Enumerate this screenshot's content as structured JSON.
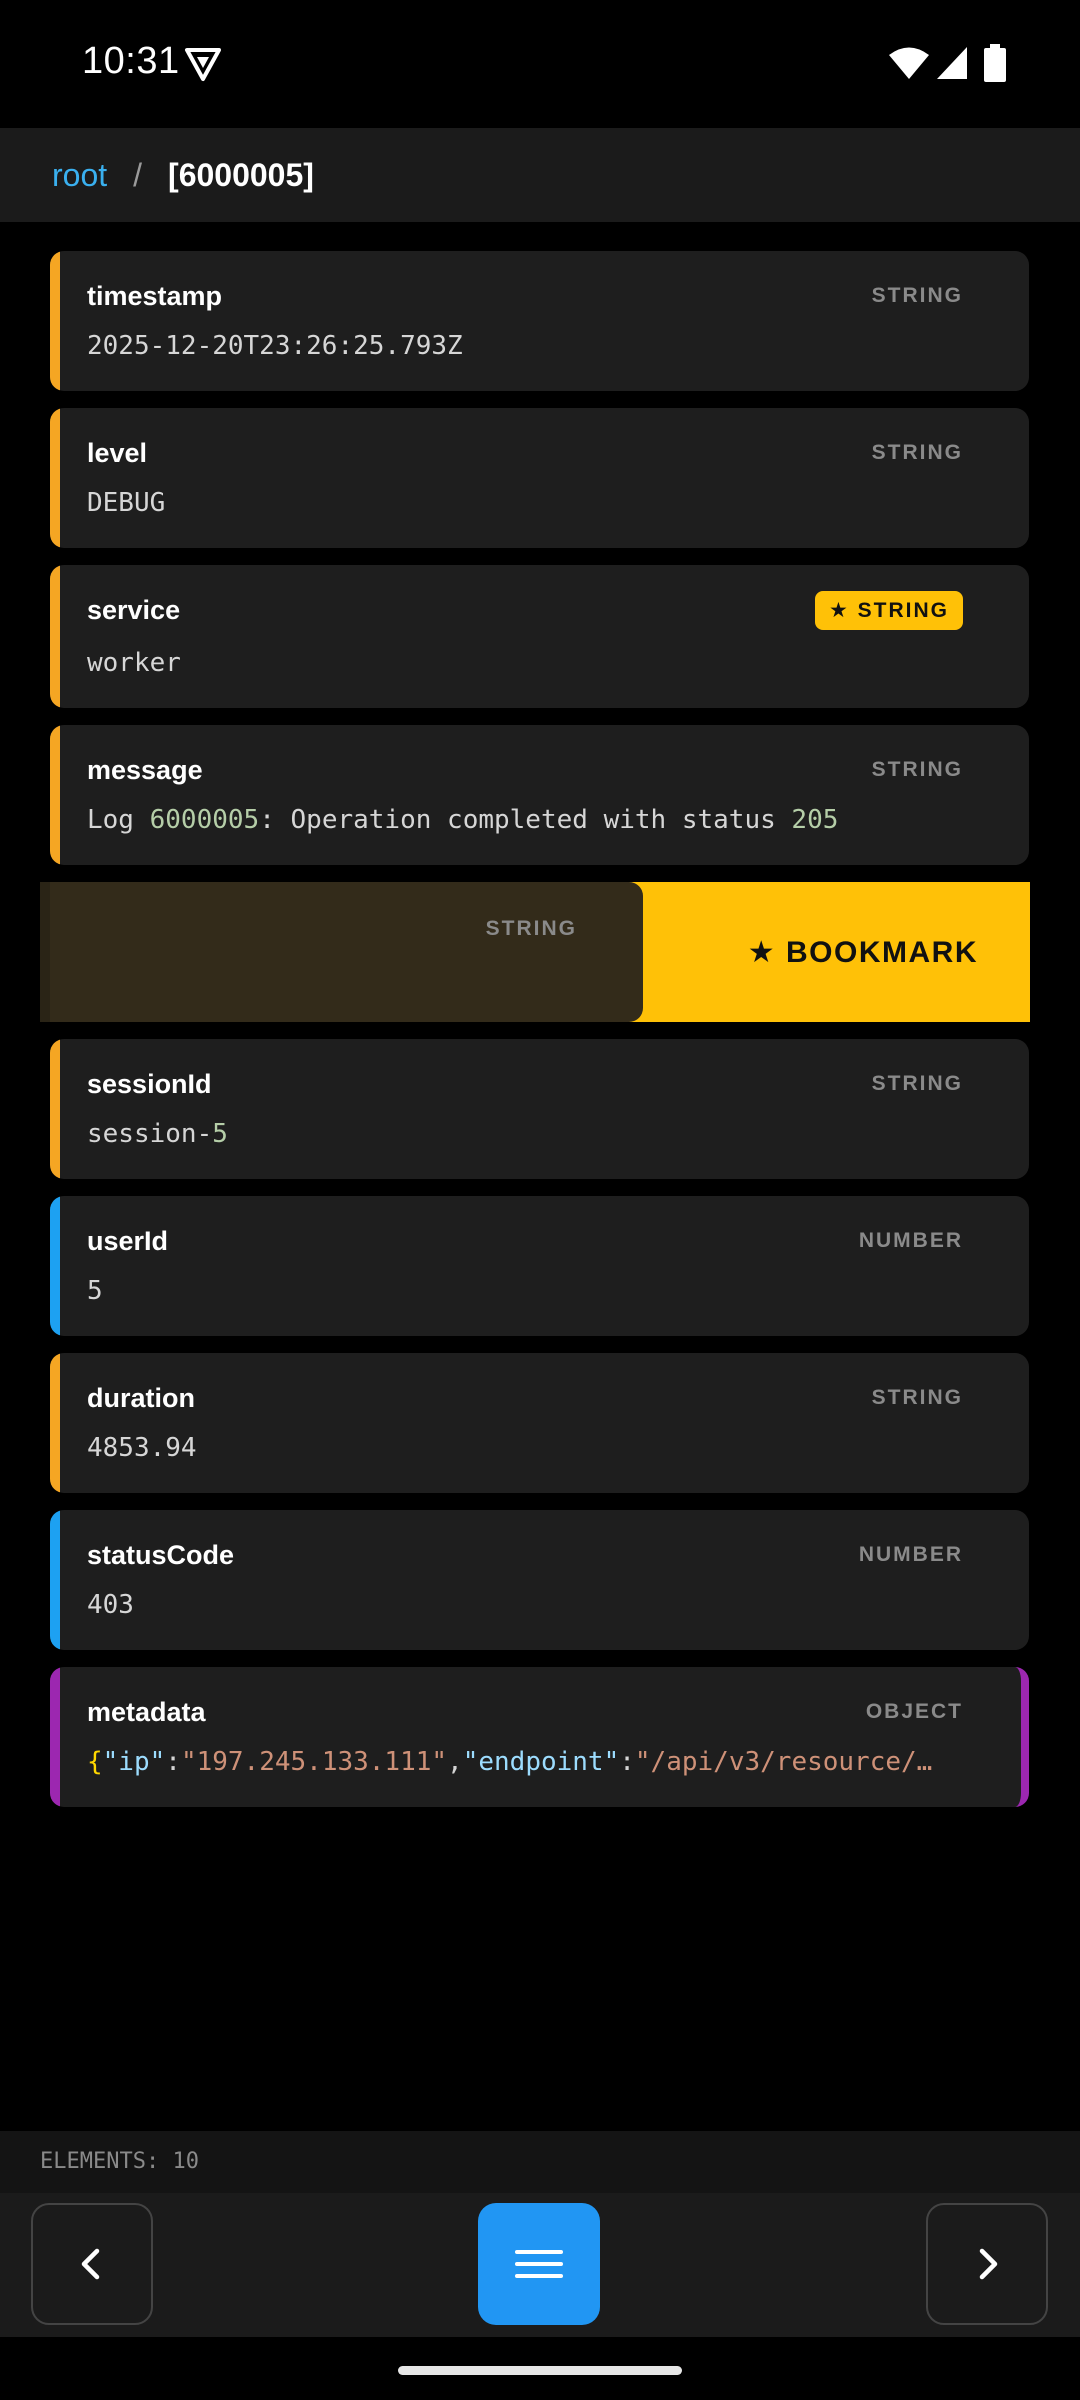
{
  "status_bar": {
    "time": "10:31"
  },
  "breadcrumb": {
    "root": "root",
    "separator": "/",
    "current": "[6000005]"
  },
  "colors": {
    "string_accent": "#f5a623",
    "number_accent": "#1da1f2",
    "object_accent": "#9c27b0",
    "bookmark": "#ffc107",
    "menu_button": "#2196f3"
  },
  "fields": [
    {
      "key": "timestamp",
      "type": "STRING",
      "value": "2025-12-20T23:26:25.793Z"
    },
    {
      "key": "level",
      "type": "STRING",
      "value": "DEBUG"
    },
    {
      "key": "service",
      "type": "STRING",
      "bookmarked": true,
      "badge": "★ STRING",
      "value": "worker"
    },
    {
      "key": "message",
      "type": "STRING",
      "value_parts": [
        "Log ",
        "6000005",
        ": Operation completed with status ",
        "205"
      ]
    },
    {
      "swiped": true,
      "type": "STRING",
      "action": "★ BOOKMARK"
    },
    {
      "key": "sessionId",
      "type": "STRING",
      "value_parts": [
        "session-",
        "5"
      ]
    },
    {
      "key": "userId",
      "type": "NUMBER",
      "value": "5"
    },
    {
      "key": "duration",
      "type": "STRING",
      "value": "4853.94"
    },
    {
      "key": "statusCode",
      "type": "NUMBER",
      "value": "403"
    },
    {
      "key": "metadata",
      "type": "OBJECT",
      "value_parts": [
        "{",
        "\"ip\"",
        ":",
        "\"197.245.133.111\"",
        ",",
        "\"endpoint\"",
        ":",
        "\"/api/v3/resource/…"
      ]
    }
  ],
  "footer": {
    "elements_label": "ELEMENTS: 10"
  },
  "nav": {
    "prev_icon": "chevron-left-icon",
    "menu_icon": "menu-icon",
    "next_icon": "chevron-right-icon"
  }
}
